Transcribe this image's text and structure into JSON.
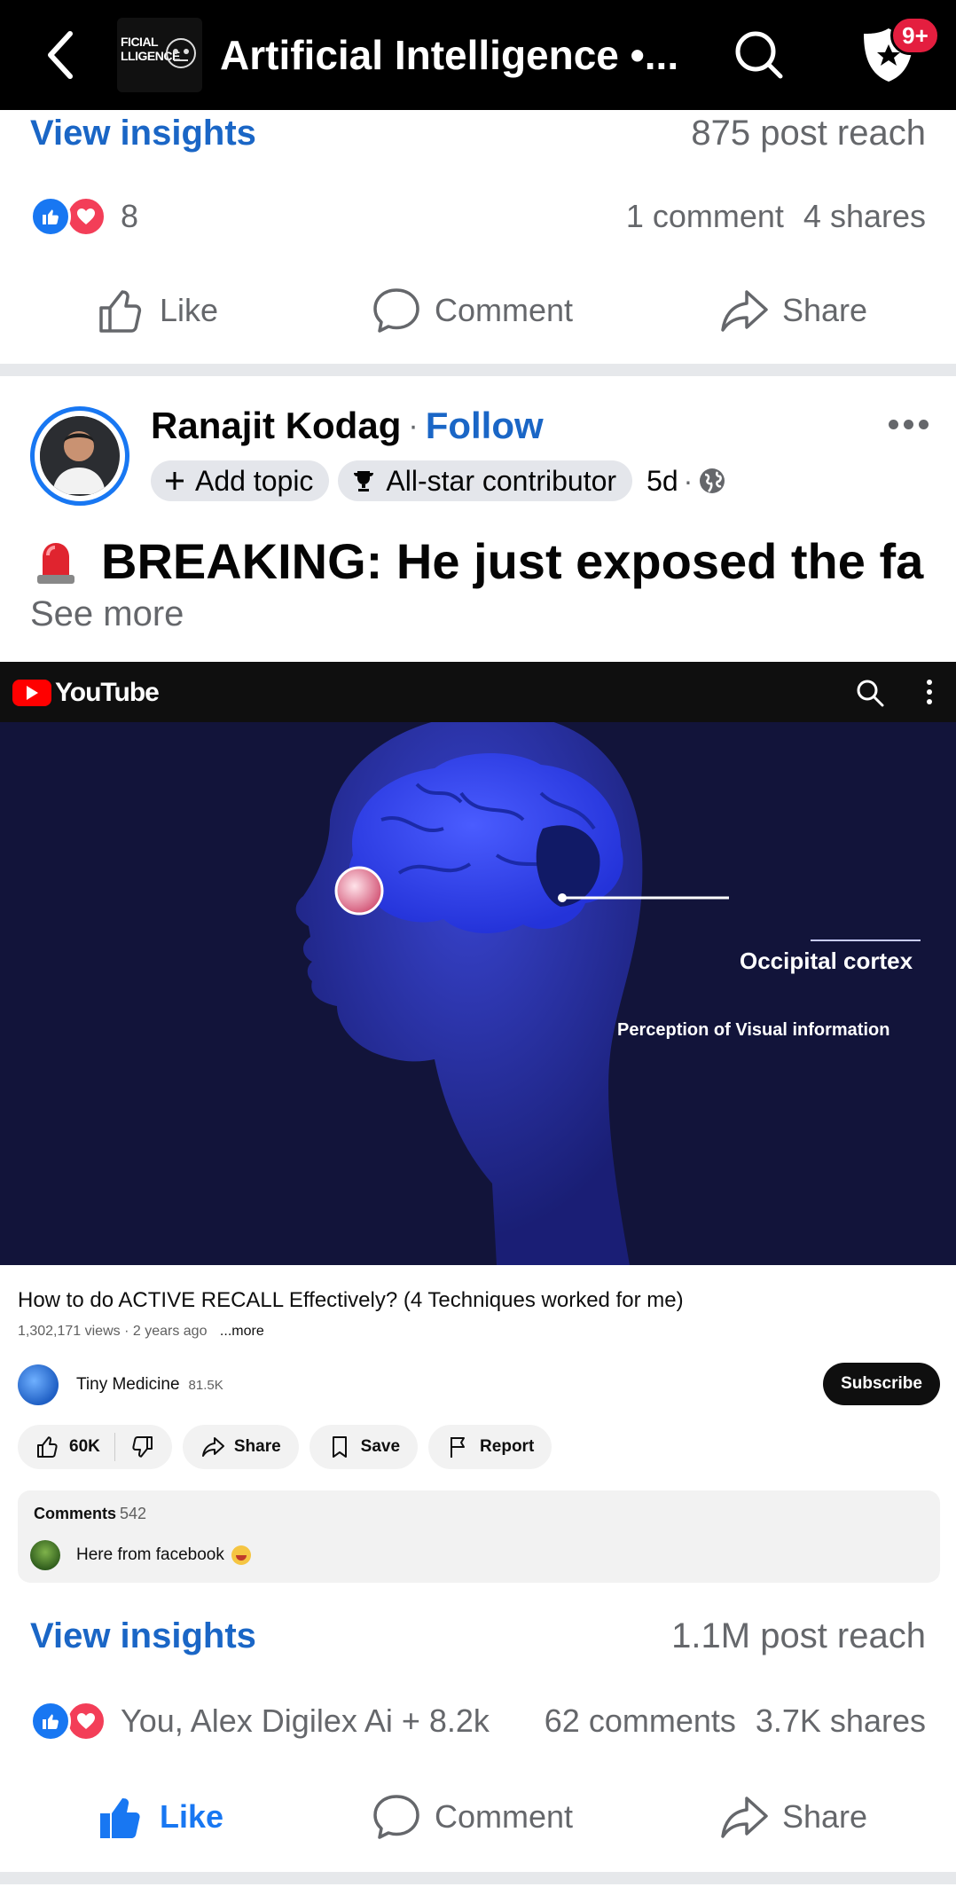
{
  "topbar": {
    "title": "Artificial Intelligence •...",
    "group_thumb_line1": "FICIAL",
    "group_thumb_line2": "LLIGENCE",
    "badge": "9+"
  },
  "post1": {
    "view_insights": "View insights",
    "reach": "875 post reach",
    "reaction_count": "8",
    "comments": "1 comment",
    "shares": "4 shares",
    "like_label": "Like",
    "comment_label": "Comment",
    "share_label": "Share"
  },
  "post2": {
    "author": "Ranajit Kodag",
    "separator": "·",
    "follow": "Follow",
    "add_topic": "Add topic",
    "contributor_badge": "All-star contributor",
    "time": "5d",
    "time_separator": "·",
    "headline": "BREAKING: He just exposed the fa...",
    "see_more": "See more",
    "view_insights": "View insights",
    "reach": "1.1M post reach",
    "reactions_text": "You, Alex Digilex Ai + 8.2k",
    "comments": "62 comments",
    "shares": "3.7K shares",
    "like_label": "Like",
    "comment_label": "Comment",
    "share_label": "Share"
  },
  "youtube": {
    "brand": "YouTube",
    "video_label_1": "Occipital cortex",
    "video_label_2": "Perception of Visual information",
    "title": "How to do ACTIVE RECALL Effectively? (4 Techniques worked for me)",
    "meta": "1,302,171 views · 2 years ago",
    "meta_more": "...more",
    "channel": "Tiny Medicine",
    "subs": "81.5K",
    "subscribe": "Subscribe",
    "likes": "60K",
    "share": "Share",
    "save": "Save",
    "report": "Report",
    "comments_label": "Comments",
    "comments_count": "542",
    "top_comment": "Here from facebook"
  },
  "colors": {
    "brand_blue": "#1877f2",
    "link_blue": "#1a66c6",
    "badge_red": "#e41e3f"
  },
  "icons": [
    "back-arrow-icon",
    "search-icon",
    "shield-star-icon",
    "like-reaction-icon",
    "love-reaction-icon",
    "thumbs-up-icon",
    "comment-icon",
    "share-icon",
    "more-dots-icon",
    "trophy-icon",
    "globe-icon",
    "siren-icon"
  ]
}
